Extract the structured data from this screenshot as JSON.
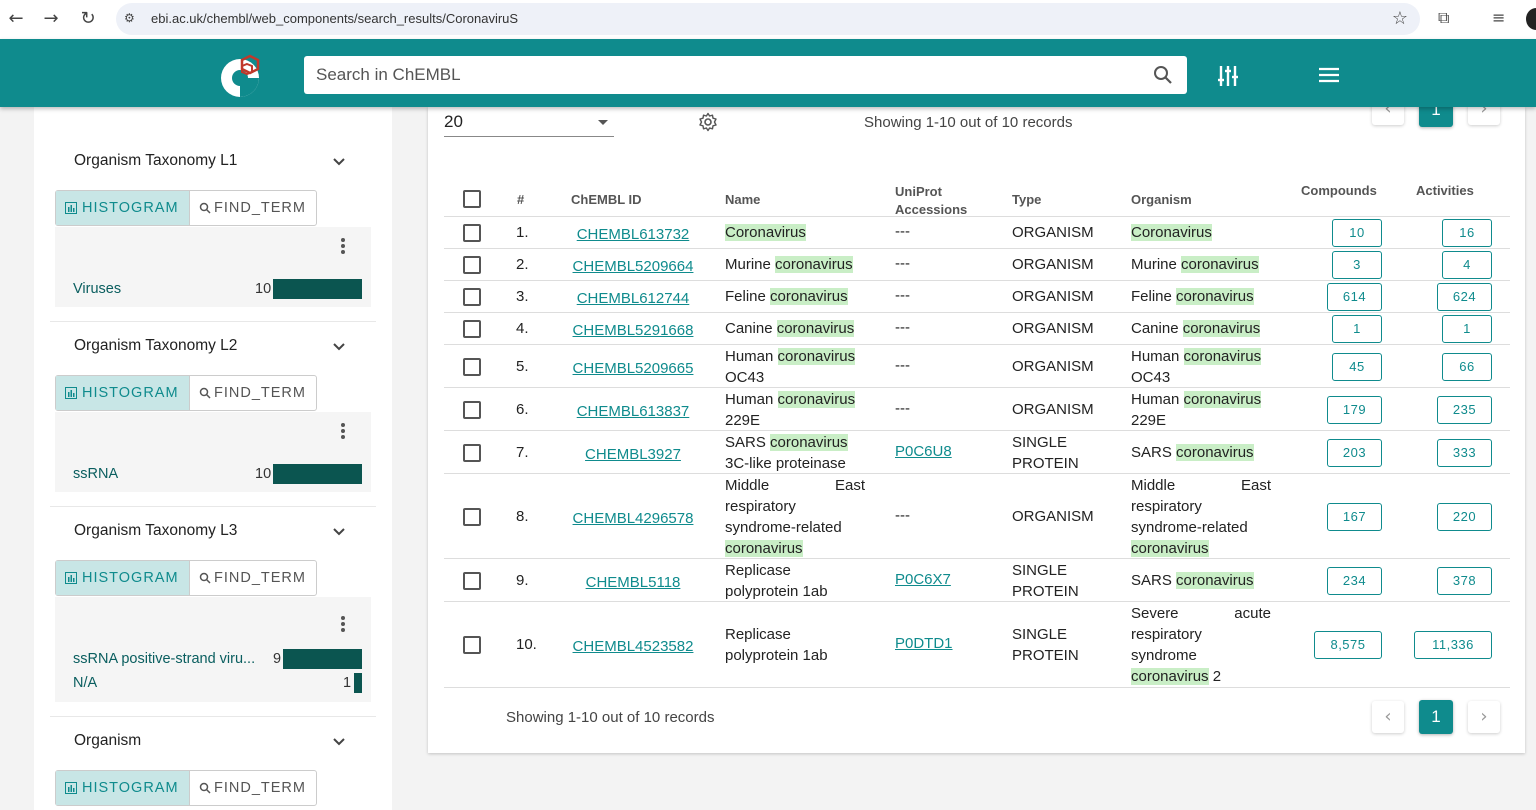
{
  "browser": {
    "url": "ebi.ac.uk/chembl/web_components/search_results/CoronaviruS",
    "back_icon": "←",
    "forward_icon": "→",
    "reload_icon": "↻"
  },
  "header": {
    "search_placeholder": "Search in ChEMBL"
  },
  "facets": [
    {
      "title": "Organism Taxonomy L1",
      "histogram_label": "HISTOGRAM",
      "find_term_label": "FIND_TERM",
      "rows": [
        {
          "label": "Viruses",
          "count": "10",
          "fraction": 1.0
        }
      ]
    },
    {
      "title": "Organism Taxonomy L2",
      "histogram_label": "HISTOGRAM",
      "find_term_label": "FIND_TERM",
      "rows": [
        {
          "label": "ssRNA",
          "count": "10",
          "fraction": 1.0
        }
      ]
    },
    {
      "title": "Organism Taxonomy L3",
      "histogram_label": "HISTOGRAM",
      "find_term_label": "FIND_TERM",
      "rows": [
        {
          "label": "ssRNA positive-strand viru...",
          "count": "9",
          "fraction": 0.9
        },
        {
          "label": "N/A",
          "count": "1",
          "fraction": 0.1
        }
      ]
    },
    {
      "title": "Organism",
      "histogram_label": "HISTOGRAM",
      "find_term_label": "FIND_TERM",
      "rows": []
    }
  ],
  "results": {
    "page_size": "20",
    "showing_top": "Showing 1-10 out of 10 records",
    "showing_bottom": "Showing 1-10 out of 10 records",
    "current_page": "1",
    "prev_icon": "‹",
    "next_icon": "›",
    "columns": {
      "index": "#",
      "chembl_id": "ChEMBL ID",
      "name": "Name",
      "uniprot": "UniProt Accessions",
      "type": "Type",
      "organism": "Organism",
      "compounds": "Compounds",
      "activities": "Activities"
    },
    "rows": [
      {
        "idx": "1.",
        "id": "CHEMBL613732",
        "name_a": "",
        "name_hl": "Coronavirus",
        "name_b": "",
        "uniprot": "---",
        "type": "ORGANISM",
        "org_a": "",
        "org_hl": "Coronavirus",
        "org_b": "",
        "compounds": "10",
        "activities": "16"
      },
      {
        "idx": "2.",
        "id": "CHEMBL5209664",
        "name_a": "Murine ",
        "name_hl": "coronavirus",
        "name_b": "",
        "uniprot": "---",
        "type": "ORGANISM",
        "org_a": "Murine ",
        "org_hl": "coronavirus",
        "org_b": "",
        "compounds": "3",
        "activities": "4"
      },
      {
        "idx": "3.",
        "id": "CHEMBL612744",
        "name_a": "Feline ",
        "name_hl": "coronavirus",
        "name_b": "",
        "uniprot": "---",
        "type": "ORGANISM",
        "org_a": "Feline ",
        "org_hl": "coronavirus",
        "org_b": "",
        "compounds": "614",
        "activities": "624"
      },
      {
        "idx": "4.",
        "id": "CHEMBL5291668",
        "name_a": "Canine ",
        "name_hl": "coronavirus",
        "name_b": "",
        "uniprot": "---",
        "type": "ORGANISM",
        "org_a": "Canine ",
        "org_hl": "coronavirus",
        "org_b": "",
        "compounds": "1",
        "activities": "1"
      },
      {
        "idx": "5.",
        "id": "CHEMBL5209665",
        "name_a": "Human ",
        "name_hl": "coronavirus",
        "name_b": " OC43",
        "uniprot": "---",
        "type": "ORGANISM",
        "org_a": "Human ",
        "org_hl": "coronavirus",
        "org_b": " OC43",
        "compounds": "45",
        "activities": "66"
      },
      {
        "idx": "6.",
        "id": "CHEMBL613837",
        "name_a": "Human ",
        "name_hl": "coronavirus",
        "name_b": " 229E",
        "uniprot": "---",
        "type": "ORGANISM",
        "org_a": "Human ",
        "org_hl": "coronavirus",
        "org_b": " 229E",
        "compounds": "179",
        "activities": "235"
      },
      {
        "idx": "7.",
        "id": "CHEMBL3927",
        "name_a": "SARS ",
        "name_hl": "coronavirus",
        "name_b": " 3C-like proteinase",
        "uniprot": "P0C6U8",
        "type": "SINGLE PROTEIN",
        "org_a": "SARS ",
        "org_hl": "coronavirus",
        "org_b": "",
        "compounds": "203",
        "activities": "333"
      },
      {
        "idx": "8.",
        "id": "CHEMBL4296578",
        "name_a": "Middle East respiratory syndrome-related ",
        "name_hl": "coronavirus",
        "name_b": "",
        "uniprot": "---",
        "type": "ORGANISM",
        "org_a": "Middle East respiratory syndrome-related ",
        "org_hl": "coronavirus",
        "org_b": "",
        "compounds": "167",
        "activities": "220"
      },
      {
        "idx": "9.",
        "id": "CHEMBL5118",
        "name_a": "Replicase polyprotein 1ab",
        "name_hl": "",
        "name_b": "",
        "uniprot": "P0C6X7",
        "type": "SINGLE PROTEIN",
        "org_a": "SARS ",
        "org_hl": "coronavirus",
        "org_b": "",
        "compounds": "234",
        "activities": "378"
      },
      {
        "idx": "10.",
        "id": "CHEMBL4523582",
        "name_a": "Replicase polyprotein 1ab",
        "name_hl": "",
        "name_b": "",
        "uniprot": "P0DTD1",
        "type": "SINGLE PROTEIN",
        "org_a": "Severe acute respiratory syndrome ",
        "org_hl": "coronavirus",
        "org_b": " 2",
        "compounds": "8,575",
        "activities": "11,336"
      }
    ]
  },
  "colors": {
    "brand": "#0f8b8d",
    "highlight": "#c9eec6",
    "bar": "#0b5550"
  }
}
